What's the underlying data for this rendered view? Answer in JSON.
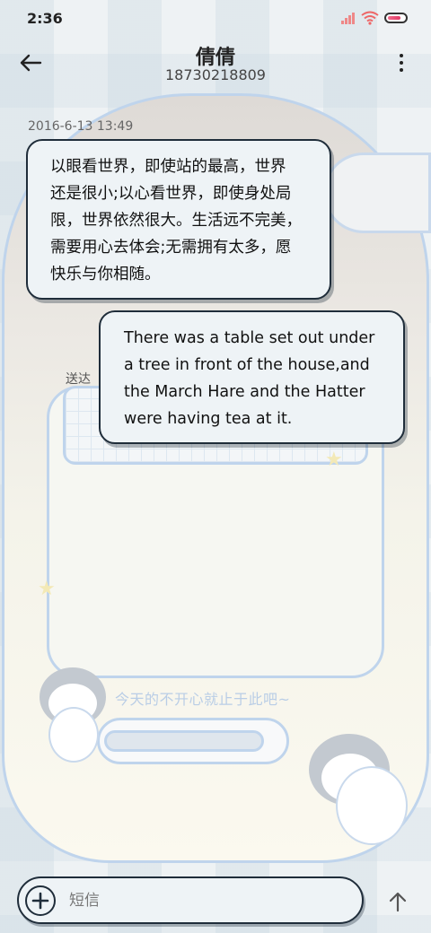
{
  "status_bar": {
    "time": "2:36",
    "battery_level_percent": 80,
    "icons": [
      "signal-icon",
      "wifi-icon",
      "battery-icon"
    ]
  },
  "header": {
    "contact_name": "倩倩",
    "contact_number": "18730218809",
    "icons": [
      "back-arrow-icon",
      "more-vertical-icon"
    ]
  },
  "conversation": {
    "timestamp": "2016-6-13 13:49",
    "messages": [
      {
        "direction": "incoming",
        "lines": [
          "以眼看世界，即使站的最高，世界",
          "还是很小;以心看世界，即使身处局",
          "限，世界依然很大。生活远不完美，",
          "需要用心去体会;无需拥有太多，愿",
          "快乐与你相随。"
        ]
      },
      {
        "direction": "outgoing",
        "status": "送达",
        "lines": [
          "There was a table set out under",
          "a tree in front of the house,and",
          "the March Hare and the Hatter",
          "were having tea at it."
        ]
      }
    ]
  },
  "wallpaper": {
    "caption": "今天的不开心就止于此吧~"
  },
  "composer": {
    "placeholder": "短信",
    "icons": [
      "add-icon",
      "send-arrow-icon"
    ]
  },
  "colors": {
    "bubble_bg": "#eef3f6",
    "bubble_border": "#1f2d3a",
    "wallpaper_accent": "#bfd4ec",
    "battery_fill": "#e23a66"
  }
}
